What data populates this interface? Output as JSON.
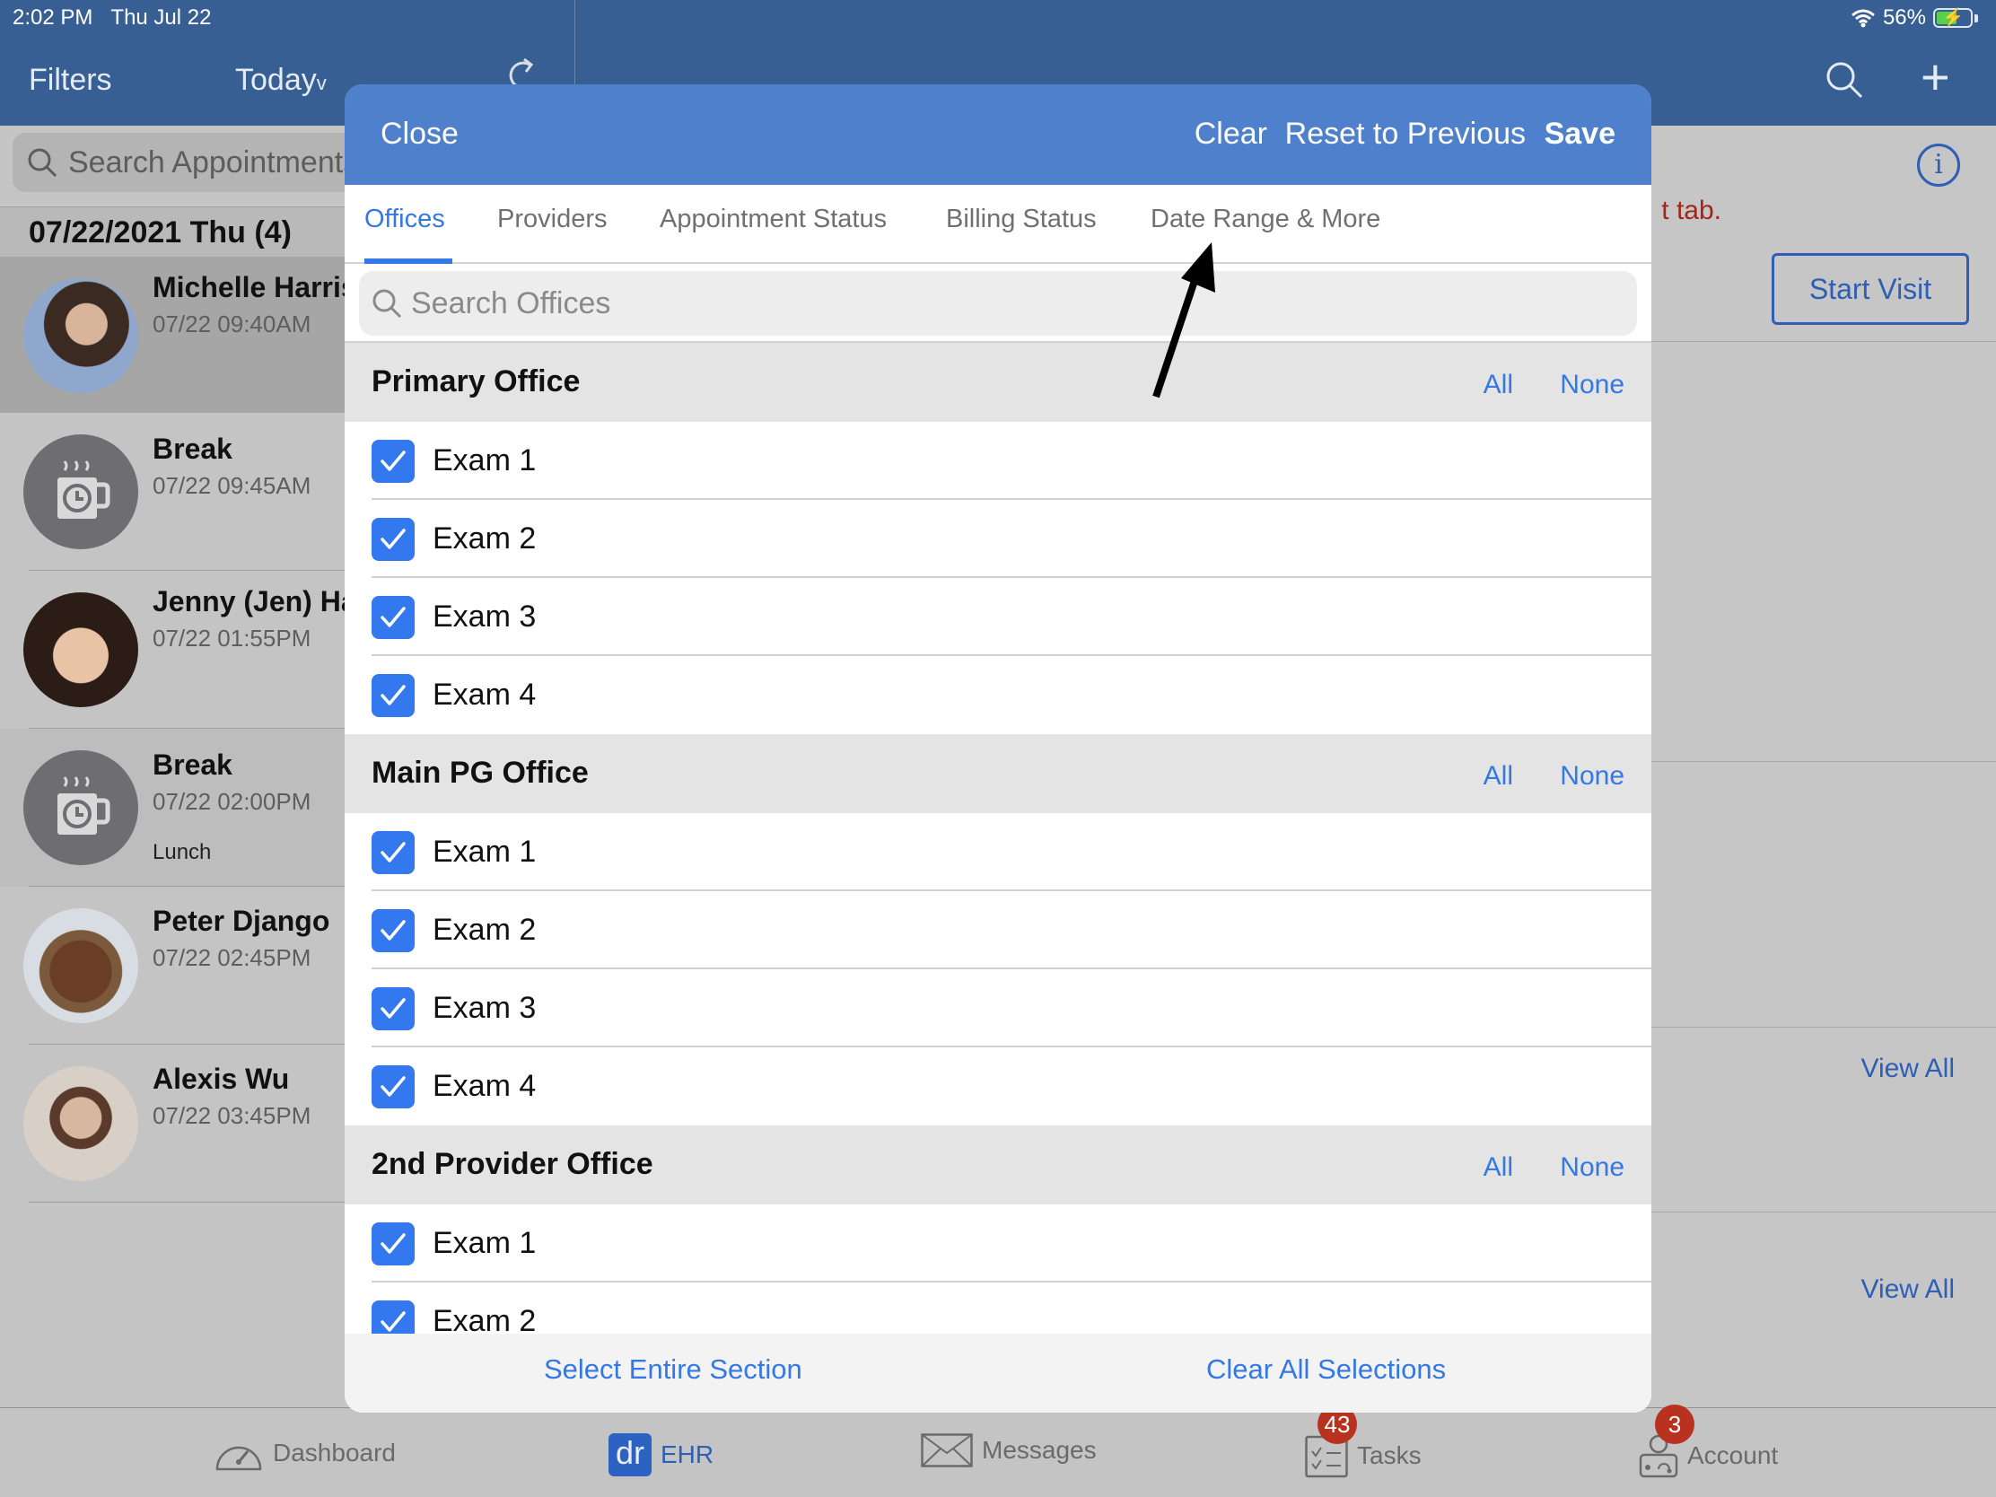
{
  "status_bar": {
    "time": "2:02 PM",
    "date": "Thu Jul 22",
    "battery": "56%"
  },
  "nav": {
    "filters": "Filters",
    "today": "Today",
    "today_chevron": "⌄"
  },
  "left": {
    "search_placeholder": "Search Appointments",
    "date_header": "07/22/2021 Thu (4)",
    "appointments": [
      {
        "name": "Michelle Harris",
        "time": "07/22 09:40AM",
        "note": "",
        "type": "patient"
      },
      {
        "name": "Break",
        "time": "07/22 09:45AM",
        "note": "",
        "type": "break"
      },
      {
        "name": "Jenny (Jen) Harris",
        "time": "07/22 01:55PM",
        "note": "",
        "type": "patient"
      },
      {
        "name": "Break",
        "time": "07/22 02:00PM",
        "note": "Lunch",
        "type": "break"
      },
      {
        "name": "Peter Django",
        "time": "07/22 02:45PM",
        "note": "",
        "type": "patient"
      },
      {
        "name": "Alexis Wu",
        "time": "07/22 03:45PM",
        "note": "",
        "type": "patient"
      }
    ]
  },
  "right": {
    "message_fragment": "t tab.",
    "start_visit": "Start Visit",
    "view_all_1": "View All",
    "view_all_2": "View All",
    "info_icon": "i"
  },
  "modal": {
    "close": "Close",
    "clear": "Clear",
    "reset": "Reset to Previous",
    "save": "Save",
    "tabs": [
      {
        "label": "Offices",
        "active": true
      },
      {
        "label": "Providers",
        "active": false
      },
      {
        "label": "Appointment Status",
        "active": false
      },
      {
        "label": "Billing Status",
        "active": false
      },
      {
        "label": "Date Range & More",
        "active": false
      }
    ],
    "search_placeholder": "Search Offices",
    "sections": [
      {
        "title": "Primary Office",
        "all": "All",
        "none": "None",
        "items": [
          {
            "label": "Exam 1",
            "checked": true
          },
          {
            "label": "Exam 2",
            "checked": true
          },
          {
            "label": "Exam 3",
            "checked": true
          },
          {
            "label": "Exam 4",
            "checked": true
          }
        ]
      },
      {
        "title": "Main PG Office",
        "all": "All",
        "none": "None",
        "items": [
          {
            "label": "Exam 1",
            "checked": true
          },
          {
            "label": "Exam 2",
            "checked": true
          },
          {
            "label": "Exam 3",
            "checked": true
          },
          {
            "label": "Exam 4",
            "checked": true
          }
        ]
      },
      {
        "title": "2nd Provider Office",
        "all": "All",
        "none": "None",
        "items": [
          {
            "label": "Exam 1",
            "checked": true
          },
          {
            "label": "Exam 2",
            "checked": true
          }
        ]
      }
    ],
    "footer": {
      "select_section": "Select Entire Section",
      "clear_all": "Clear All Selections"
    }
  },
  "tabbar": {
    "items": [
      {
        "label": "Dashboard",
        "icon": "dashboard-gauge-icon",
        "active": false
      },
      {
        "label": "EHR",
        "icon": "dr-logo-icon",
        "logo_text": "dr",
        "active": true
      },
      {
        "label": "Messages",
        "icon": "envelope-icon",
        "active": false
      },
      {
        "label": "Tasks",
        "icon": "checklist-icon",
        "badge": "43",
        "active": false
      },
      {
        "label": "Account",
        "icon": "doctor-icon",
        "badge": "3",
        "active": false
      }
    ]
  },
  "colors": {
    "nav_blue": "#385f94",
    "modal_header": "#4e80cb",
    "accent": "#3478e6",
    "badge_red": "#b8321f",
    "link_blue": "#2e5fb4"
  }
}
